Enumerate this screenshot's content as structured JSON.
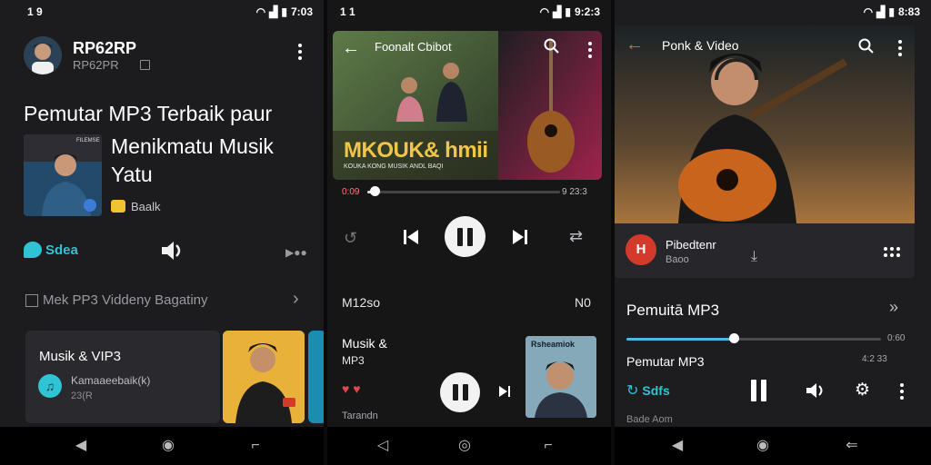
{
  "panel1": {
    "status_left": "1 9",
    "status_time": "7:03",
    "profile_name": "RP62RP",
    "profile_sub": "RP62PR",
    "headline": "Pemutar MP3 Terbaik paur",
    "headline2": "Menikmatu Musik Yatu",
    "album_tag": "FILEMSE",
    "badge_label": "Baalk",
    "chip_label": "Sdea",
    "section_title": "Mek PP3 Viddeny Bagatiny",
    "card_title": "Musik & VIP3",
    "card_sub": "Kamaaeebaik(k)",
    "card_meta": "23(R"
  },
  "panel2": {
    "status_left": "1 1",
    "status_time": "9:2:3",
    "header_title": "Foonalt Cbibot",
    "banner_text": "MKOUK& hmii",
    "banner_sub": "KOUKA  KONG  MUSIK  ANDL  BAQI",
    "time_elapsed": "0:09",
    "time_total": "9 23:3",
    "track_left": "M12so",
    "track_right": "N0",
    "mini_title": "Musik &",
    "mini_sub": "MP3",
    "mini_meta": "Tarandn",
    "thumb_label": "Rsheamiok"
  },
  "panel3": {
    "status_time": "8:83",
    "header_title": "Ponk & Video",
    "avatar_letter": "H",
    "artist_name": "Pibedtenr",
    "artist_sub": "Baoo",
    "song_title": "Pemuitā MP3",
    "time_right": "0:60",
    "sub_title": "Pemutar MP3",
    "sub_time": "4:2 33",
    "chip_label": "Sdfs",
    "footer_text": "Bade Aom"
  },
  "colors": {
    "accent_teal": "#2ec4d6",
    "avatar_red": "#d33a2c",
    "badge_yellow": "#f2c230"
  },
  "progress": {
    "panel2_fraction": 0.04,
    "panel3_fraction": 0.42
  }
}
